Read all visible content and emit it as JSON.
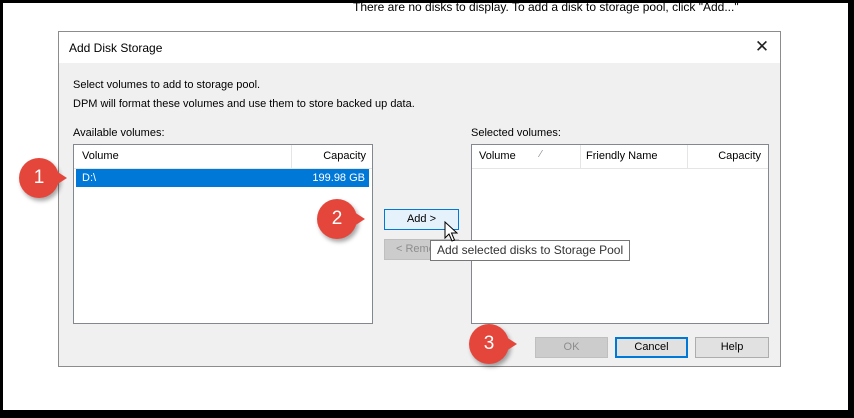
{
  "background_message": "There are no disks to display. To add a disk to storage pool, click \"Add...\"",
  "dialog": {
    "title": "Add Disk Storage",
    "instruction_line1": "Select volumes to add to storage pool.",
    "instruction_line2": "DPM will format these volumes and use them to store backed up data.",
    "available": {
      "label": "Available volumes:",
      "columns": [
        "Volume",
        "Capacity"
      ],
      "rows": [
        {
          "volume": "D:\\",
          "capacity": "199.98 GB",
          "selected": true
        }
      ]
    },
    "selected": {
      "label": "Selected volumes:",
      "columns": [
        "Volume",
        "Friendly Name",
        "Capacity"
      ],
      "rows": []
    },
    "buttons": {
      "add": "Add >",
      "remove": "< Remo",
      "ok": "OK",
      "cancel": "Cancel",
      "help": "Help"
    },
    "tooltip": "Add selected disks to Storage Pool"
  },
  "callouts": [
    "1",
    "2",
    "3"
  ],
  "colors": {
    "selection": "#0078d7",
    "callout": "#e5463b"
  }
}
